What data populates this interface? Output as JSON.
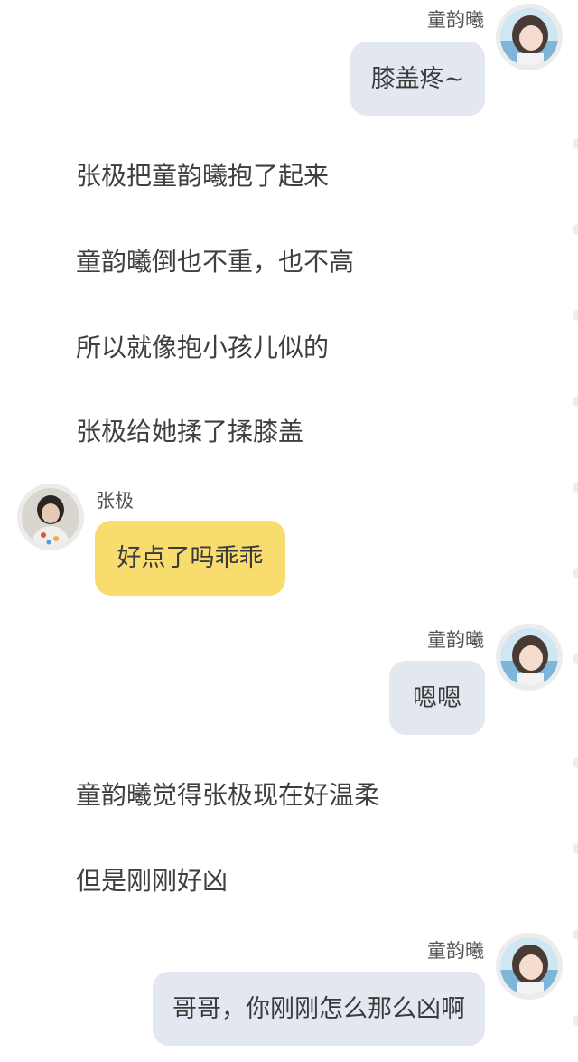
{
  "colors": {
    "page_bg": "#ffffff",
    "bubble_self": "#e3e7ef",
    "bubble_other": "#f9dc6e",
    "avatar_ring": "#ececec"
  },
  "messages": [
    {
      "kind": "chat",
      "side": "right",
      "sender": "童韵曦",
      "text": "膝盖疼~",
      "avatar_icon": "girl-avatar-icon"
    },
    {
      "kind": "narration",
      "text": "张极把童韵曦抱了起来"
    },
    {
      "kind": "narration",
      "text": "童韵曦倒也不重，也不高"
    },
    {
      "kind": "narration",
      "text": "所以就像抱小孩儿似的"
    },
    {
      "kind": "narration",
      "text": "张极给她揉了揉膝盖"
    },
    {
      "kind": "chat",
      "side": "left",
      "sender": "张极",
      "text": "好点了吗乖乖",
      "avatar_icon": "boy-avatar-icon"
    },
    {
      "kind": "chat",
      "side": "right",
      "sender": "童韵曦",
      "text": "嗯嗯",
      "avatar_icon": "girl-avatar-icon"
    },
    {
      "kind": "narration",
      "text": "童韵曦觉得张极现在好温柔"
    },
    {
      "kind": "narration",
      "text": "但是刚刚好凶"
    },
    {
      "kind": "chat",
      "side": "right",
      "sender": "童韵曦",
      "text": "哥哥，你刚刚怎么那么凶啊",
      "avatar_icon": "girl-avatar-icon"
    }
  ]
}
